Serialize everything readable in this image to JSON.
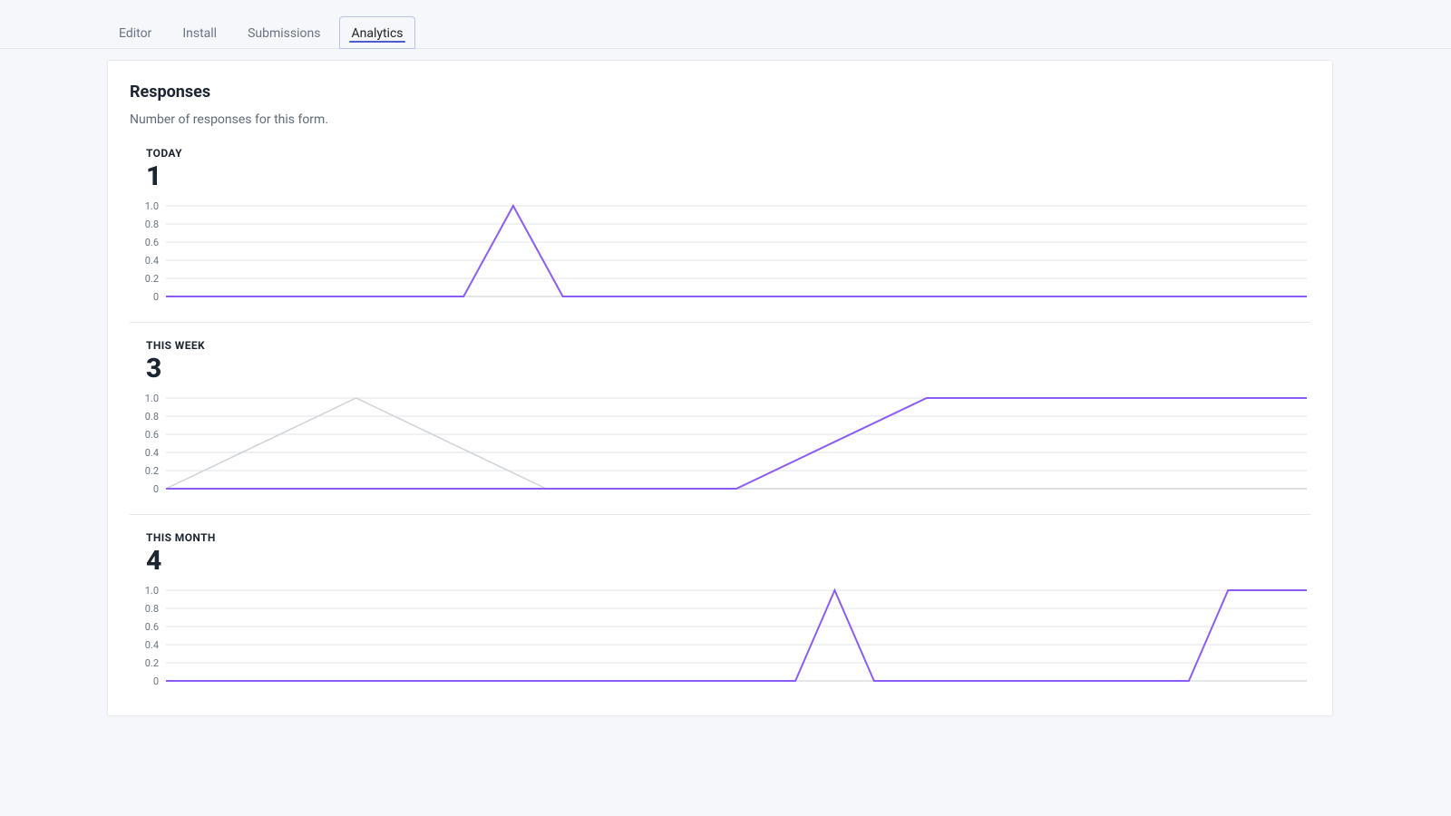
{
  "tabs": [
    {
      "label": "Editor",
      "active": false
    },
    {
      "label": "Install",
      "active": false
    },
    {
      "label": "Submissions",
      "active": false
    },
    {
      "label": "Analytics",
      "active": true
    }
  ],
  "card": {
    "title": "Responses",
    "subtitle": "Number of responses for this form."
  },
  "accent_color": "#8b5cf6",
  "chart_data": [
    {
      "id": "today",
      "label": "TODAY",
      "total": "1",
      "type": "line",
      "y_ticks": [
        "0",
        "0.2",
        "0.4",
        "0.6",
        "0.8",
        "1.0"
      ],
      "ylim": [
        0,
        1
      ],
      "n_points": 24,
      "series": [
        {
          "name": "current",
          "values": [
            0,
            0,
            0,
            0,
            0,
            0,
            0,
            1,
            0,
            0,
            0,
            0,
            0,
            0,
            0,
            0,
            0,
            0,
            0,
            0,
            0,
            0,
            0,
            0
          ]
        }
      ]
    },
    {
      "id": "this_week",
      "label": "THIS WEEK",
      "total": "3",
      "type": "line",
      "y_ticks": [
        "0",
        "0.2",
        "0.4",
        "0.6",
        "0.8",
        "1.0"
      ],
      "ylim": [
        0,
        1
      ],
      "n_points": 7,
      "series": [
        {
          "name": "previous",
          "values": [
            0,
            1,
            0,
            0,
            0,
            0,
            0
          ]
        },
        {
          "name": "current",
          "values": [
            0,
            0,
            0,
            0,
            1,
            1,
            1
          ]
        }
      ]
    },
    {
      "id": "this_month",
      "label": "THIS MONTH",
      "total": "4",
      "type": "line",
      "y_ticks": [
        "0",
        "0.2",
        "0.4",
        "0.6",
        "0.8",
        "1.0"
      ],
      "ylim": [
        0,
        1
      ],
      "n_points": 30,
      "series": [
        {
          "name": "current",
          "values": [
            0,
            0,
            0,
            0,
            0,
            0,
            0,
            0,
            0,
            0,
            0,
            0,
            0,
            0,
            0,
            0,
            0,
            1,
            0,
            0,
            0,
            0,
            0,
            0,
            0,
            0,
            0,
            1,
            1,
            1
          ]
        }
      ]
    }
  ]
}
